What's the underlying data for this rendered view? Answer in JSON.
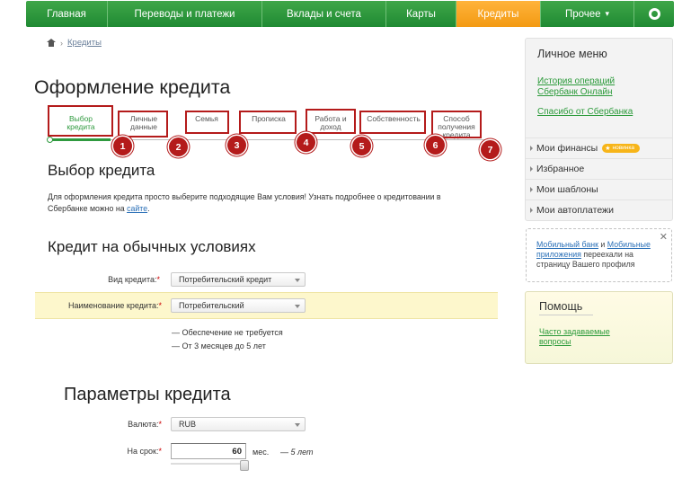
{
  "nav": {
    "items": [
      {
        "label": "Главная"
      },
      {
        "label": "Переводы и платежи"
      },
      {
        "label": "Вклады и счета"
      },
      {
        "label": "Карты"
      },
      {
        "label": "Кредиты"
      },
      {
        "label": "Прочее"
      }
    ],
    "active_index": 4
  },
  "breadcrumb": {
    "link": "Кредиты"
  },
  "page_title": "Оформление кредита",
  "steps": [
    {
      "label": "Выбор кредита",
      "num": "1"
    },
    {
      "label": "Личные данные",
      "num": "2"
    },
    {
      "label": "Семья",
      "num": "3"
    },
    {
      "label": "Прописка",
      "num": "4"
    },
    {
      "label": "Работа и доход",
      "num": "5"
    },
    {
      "label": "Собственность",
      "num": "6"
    },
    {
      "label": "Способ получения кредита",
      "num": "7"
    }
  ],
  "section1": {
    "title": "Выбор кредита",
    "intro_text": "Для оформления кредита просто выберите подходящие Вам условия! Узнать подробнее о кредитовании в Сбербанке можно на ",
    "intro_link": "сайте",
    "intro_end": "."
  },
  "section2": {
    "title": "Кредит на обычных условиях",
    "credit_type_label": "Вид кредита:",
    "credit_type_value": "Потребительский кредит",
    "credit_name_label": "Наименование кредита:",
    "credit_name_value": "Потребительский",
    "note1": "— Обеспечение не требуется",
    "note2": "— От 3 месяцев до 5 лет"
  },
  "section3": {
    "title": "Параметры кредита",
    "currency_label": "Валюта:",
    "currency_value": "RUB",
    "term_label": "На срок:",
    "term_value": "60",
    "term_unit": "мес.",
    "term_years": "— 5 лет"
  },
  "required_mark": "*",
  "sidebar": {
    "menu_title": "Личное меню",
    "links": [
      "История операций Сбербанк Онлайн",
      "Спасибо от Сбербанка"
    ],
    "items": [
      {
        "label": "Мои финансы",
        "badge": "новинка"
      },
      {
        "label": "Избранное"
      },
      {
        "label": "Мои шаблоны"
      },
      {
        "label": "Мои автоплатежи"
      }
    ],
    "mobile": {
      "link1": "Мобильный банк",
      "and": " и ",
      "link2": "Мобильные приложения",
      "rest": " переехали на страницу Вашего профиля"
    },
    "help": {
      "title": "Помощь",
      "link": "Часто задаваемые вопросы"
    }
  },
  "colors": {
    "nav_green": "#2a9a3c",
    "nav_active": "#f7a21b",
    "annotation_red": "#b41b1b",
    "link_green": "#2b9a3a"
  }
}
